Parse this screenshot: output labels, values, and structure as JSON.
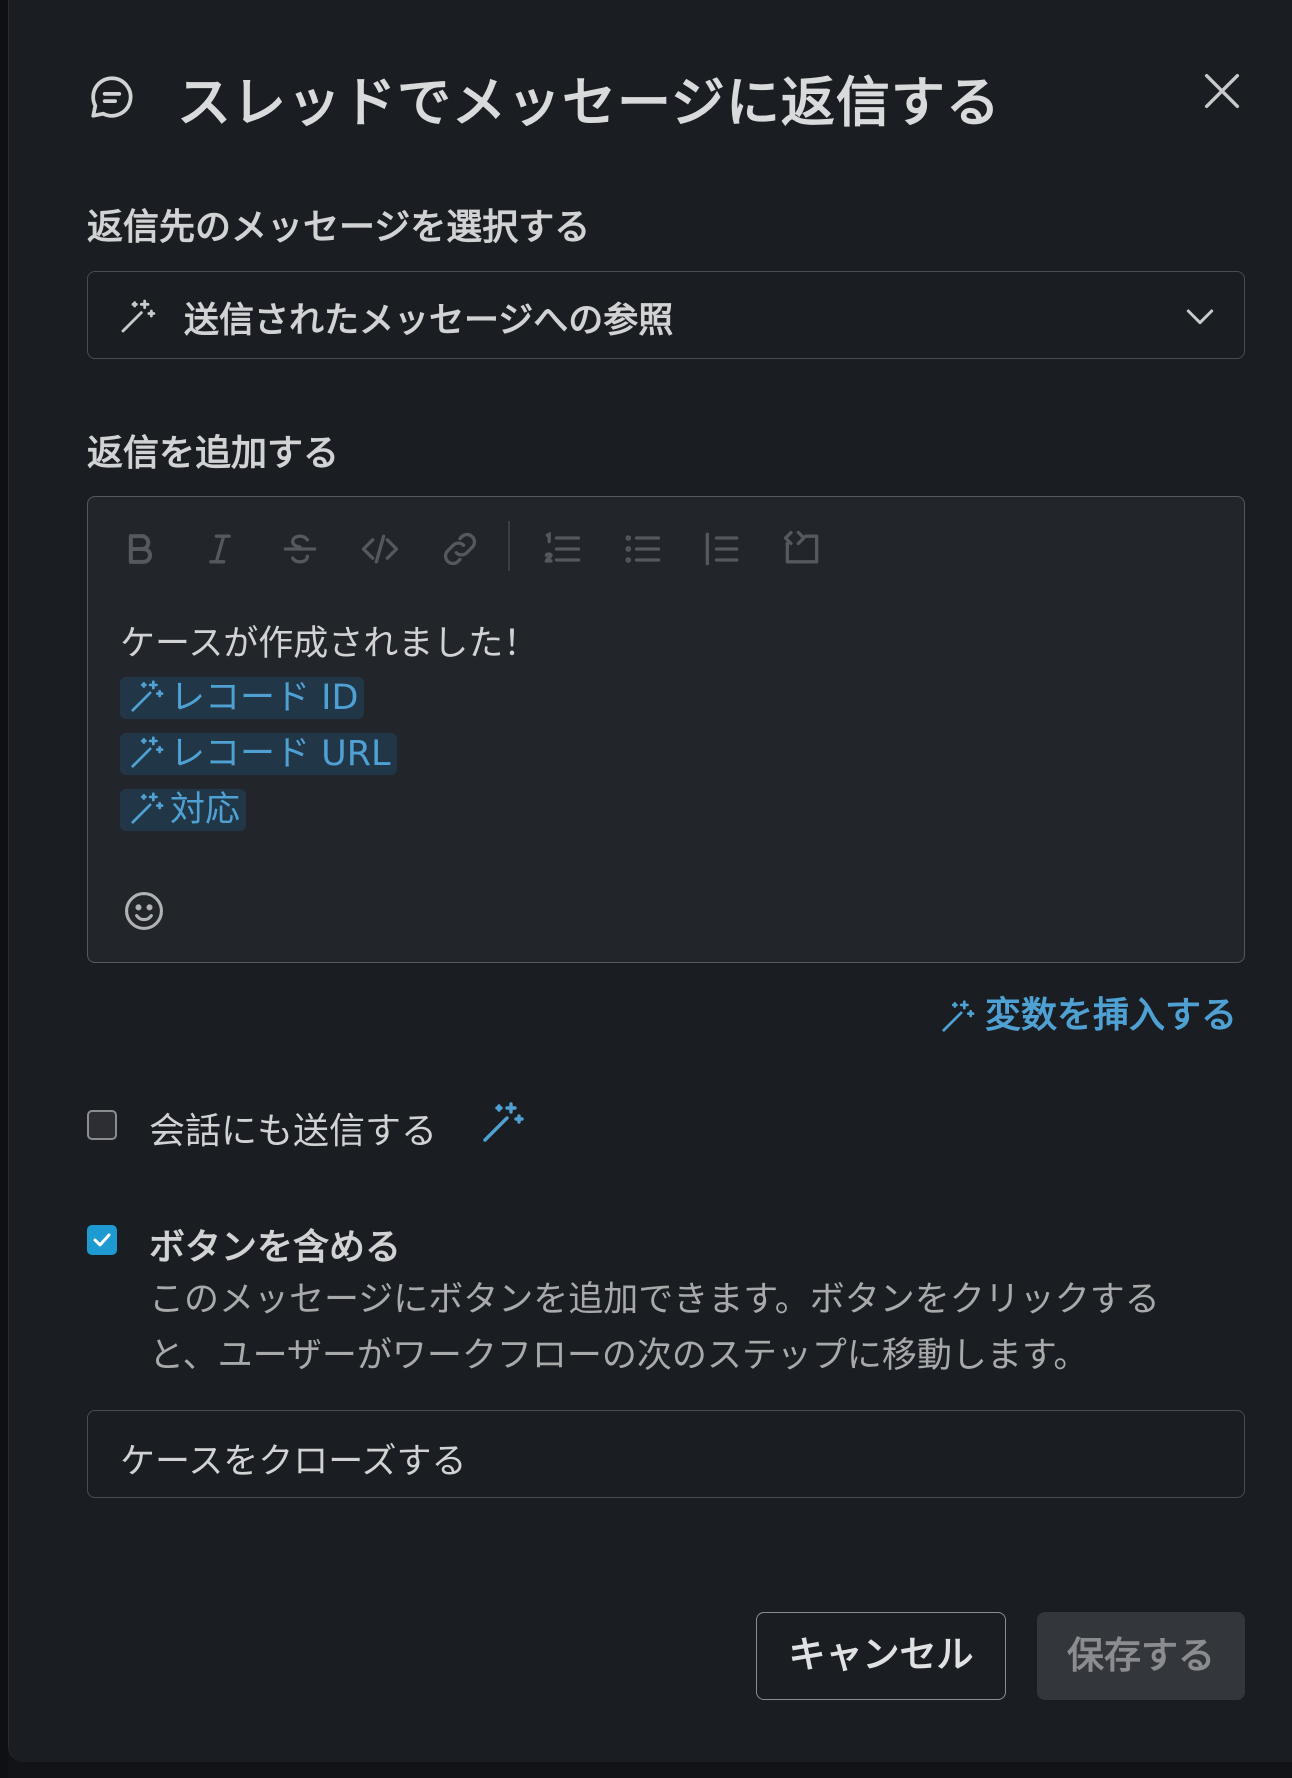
{
  "header": {
    "title": "スレッドでメッセージに返信する"
  },
  "select_section": {
    "label": "返信先のメッセージを選択する",
    "value": "送信されたメッセージへの参照"
  },
  "reply_section": {
    "label": "返信を追加する",
    "text": "ケースが作成されました！",
    "tokens": [
      "レコード ID",
      "レコード URL",
      "対応"
    ]
  },
  "insert_variable": "変数を挿入する",
  "options": {
    "send_to_conversation": {
      "label": "会話にも送信する",
      "checked": false
    },
    "include_button": {
      "label": "ボタンを含める",
      "checked": true,
      "description_line1": "このメッセージにボタンを追加できます。ボタンをクリックする",
      "description_line2": "と、ユーザーがワークフローの次のステップに移動します。"
    }
  },
  "button_text_value": "ケースをクローズする",
  "footer": {
    "cancel_label": "キャンセル",
    "save_label": "保存する"
  },
  "colors": {
    "accent": "#4fa1d4",
    "checkbox": "#1d9bd1",
    "panel": "#1a1d21",
    "editor": "#222529"
  }
}
